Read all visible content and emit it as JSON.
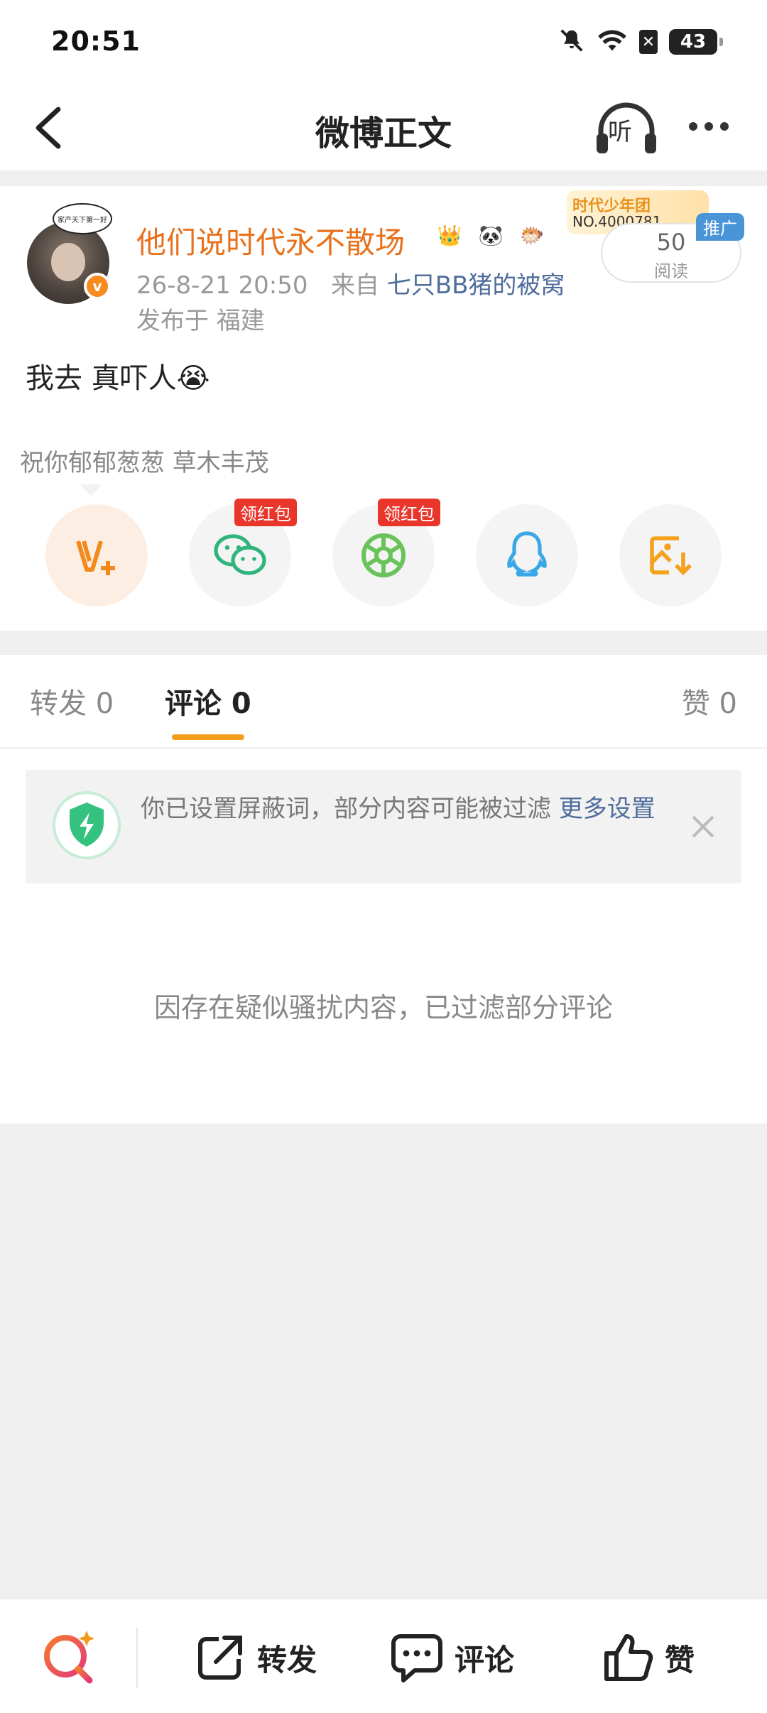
{
  "status_bar": {
    "time": "20:51",
    "battery": "43"
  },
  "nav": {
    "title": "微博正文",
    "listen_label": "听"
  },
  "post": {
    "avatar_bubble": "家产天下第一好",
    "username": "他们说时代永不散场",
    "fan_badge_title": "时代少年团",
    "fan_badge_no": "NO.4000781",
    "read_count": "50",
    "read_label": "阅读",
    "promo_tag": "推广",
    "timestamp": "26-8-21 20:50",
    "source_prefix": "来自",
    "source": "七只BB猪的被窝",
    "location": "发布于 福建",
    "text": "我去 真吓人😭",
    "signature": "祝你郁郁葱葱 草木丰茂",
    "share_tag_1": "领红包",
    "share_tag_2": "领红包"
  },
  "tabs": {
    "repost": "转发 0",
    "comment": "评论 0",
    "like": "赞 0"
  },
  "filter_banner": {
    "text": "你已设置屏蔽词，部分内容可能被过滤 ",
    "link": "更多设置"
  },
  "empty_note": "因存在疑似骚扰内容，已过滤部分评论",
  "bottom_bar": {
    "repost": "转发",
    "comment": "评论",
    "like": "赞"
  },
  "colors": {
    "accent": "#f49c1b",
    "username": "#e8711c",
    "link": "#4f6d9b",
    "red_tag": "#e9362b"
  }
}
